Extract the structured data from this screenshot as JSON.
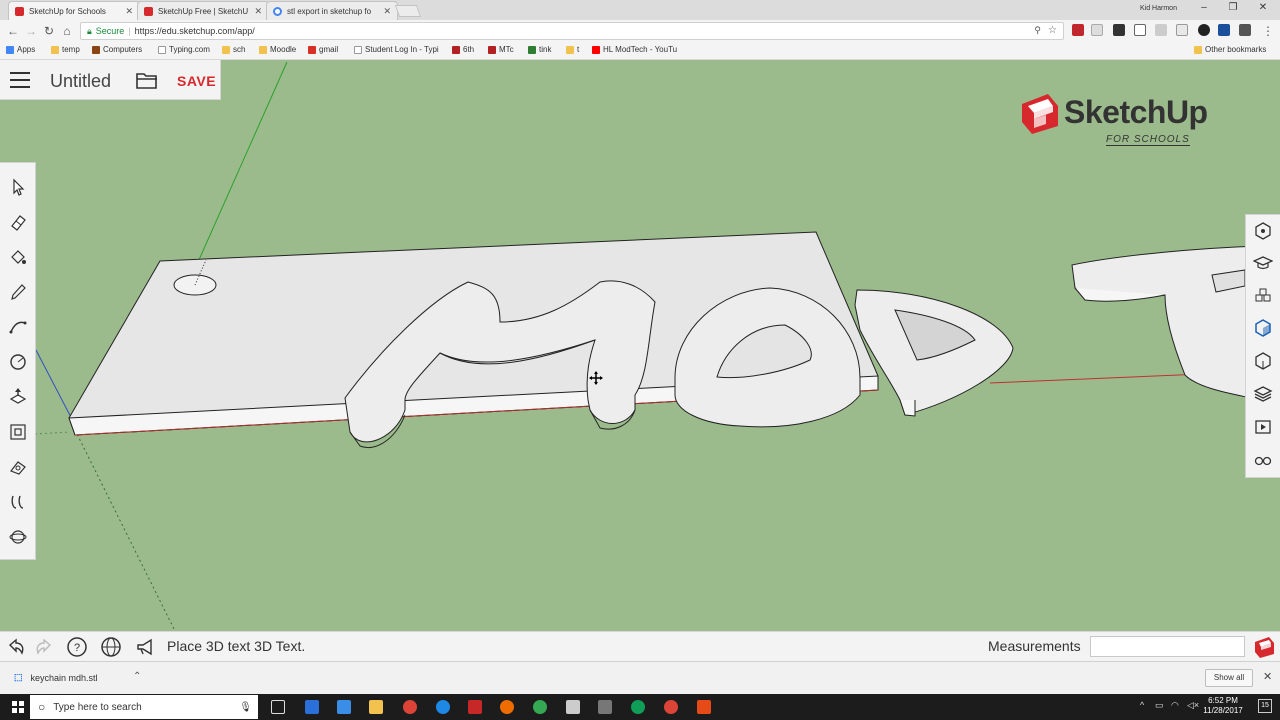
{
  "browser": {
    "tabs": [
      {
        "title": "SketchUp for Schools",
        "favicon_color": "#d6282d",
        "active": true
      },
      {
        "title": "SketchUp Free | SketchU",
        "favicon_color": "#d6282d",
        "active": false
      },
      {
        "title": "stl export in sketchup fo",
        "favicon_color": "#4285f4",
        "active": false
      }
    ],
    "close_glyph": "✕",
    "user_name": "Kid Harmon",
    "security_label": "Secure",
    "url": "https://edu.sketchup.com/app/",
    "bookmarks": [
      "Apps",
      "temp",
      "Computers",
      "Typing.com",
      "sch",
      "Moodle",
      "gmail",
      "Student Log In - Typi",
      "6th",
      "MTc",
      "tink",
      "t",
      "HL ModTech - YouTu"
    ],
    "other_bookmarks": "Other bookmarks"
  },
  "app": {
    "document_title": "Untitled",
    "save_label": "SAVE",
    "logo_word": "SketchUp",
    "logo_sub": "FOR SCHOOLS",
    "brand_color": "#d6282d",
    "canvas_color": "#9cbb8c",
    "left_tools": [
      "select-icon",
      "eraser-icon",
      "paint-bucket-icon",
      "pencil-icon",
      "arc-icon",
      "circle-icon",
      "push-pull-icon",
      "offset-icon",
      "tape-measure-icon",
      "orbit-icon",
      "pan-icon"
    ],
    "right_panels": [
      "entity-info-icon",
      "instructor-icon",
      "components-icon",
      "materials-icon",
      "styles-icon",
      "layers-icon",
      "scenes-icon",
      "display-icon"
    ]
  },
  "status": {
    "message": "Place 3D text 3D Text.",
    "measurements_label": "Measurements",
    "measurements_value": ""
  },
  "downloads": {
    "file_name": "keychain mdh.stl",
    "show_all_label": "Show all"
  },
  "taskbar": {
    "search_placeholder": "Type here to search",
    "time": "6:52 PM",
    "date": "11/28/2017",
    "notification_count": "15"
  }
}
